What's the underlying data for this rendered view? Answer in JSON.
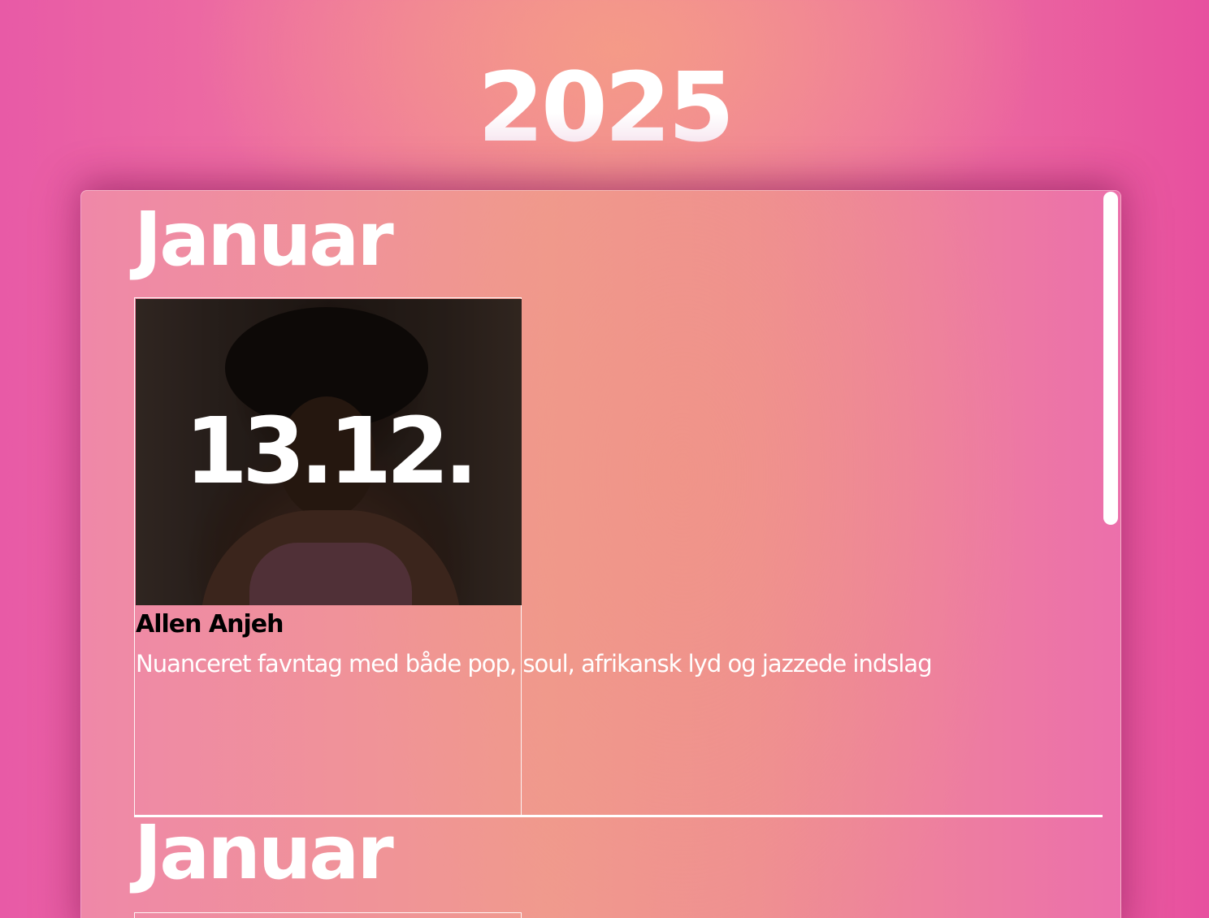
{
  "page": {
    "year": "2025"
  },
  "months": [
    {
      "name": "Januar",
      "events": [
        {
          "date": "13.12.",
          "title": "Allen Anjeh",
          "description": "Nuanceret favntag med både pop, soul, afrikansk lyd og jazzede indslag",
          "image": "artist-photo"
        }
      ]
    },
    {
      "name": "Januar",
      "events": []
    }
  ],
  "colors": {
    "background_pink": "#e85aa6",
    "background_peach": "#f08896",
    "text_white": "#ffffff",
    "title_black": "#000000"
  }
}
